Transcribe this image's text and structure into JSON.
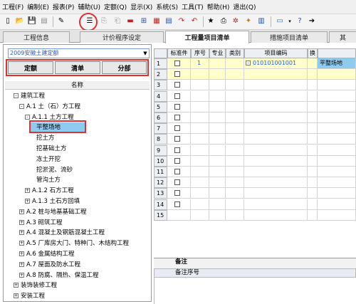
{
  "menu": [
    "工程(F)",
    "编制(E)",
    "报表(P)",
    "辅助(U)",
    "定额(Q)",
    "显示(X)",
    "系统(S)",
    "工具(T)",
    "帮助(H)",
    "退出(Q)"
  ],
  "tabs": [
    "工程信息",
    "计价程序设定",
    "工程量项目清单",
    "措施项目清单",
    "其"
  ],
  "active_tab": "工程量项目清单",
  "left_panel": {
    "quota_select": "2009安徽土建定额",
    "subtabs": [
      "定额",
      "清单",
      "分部"
    ],
    "tree_header": "名称",
    "tree": [
      {
        "label": "建筑工程",
        "level": 0,
        "toggle": "-"
      },
      {
        "label": "A.1 土（石）方工程",
        "level": 1,
        "toggle": "-"
      },
      {
        "label": "A.1.1 土方工程",
        "level": 2,
        "toggle": "-"
      },
      {
        "label": "平整场地",
        "level": 3,
        "toggle": "",
        "selected": true
      },
      {
        "label": "挖土方",
        "level": 3,
        "toggle": ""
      },
      {
        "label": "挖基础土方",
        "level": 3,
        "toggle": ""
      },
      {
        "label": "冻土开挖",
        "level": 3,
        "toggle": ""
      },
      {
        "label": "挖淤泥、流砂",
        "level": 3,
        "toggle": ""
      },
      {
        "label": "管沟土方",
        "level": 3,
        "toggle": ""
      },
      {
        "label": "A.1.2 石方工程",
        "level": 2,
        "toggle": "+"
      },
      {
        "label": "A.1.3 土石方回填",
        "level": 2,
        "toggle": "+"
      },
      {
        "label": "A.2 桩与地基基础工程",
        "level": 1,
        "toggle": "+"
      },
      {
        "label": "A.3 砌筑工程",
        "level": 1,
        "toggle": "+"
      },
      {
        "label": "A.4 混凝土及钢筋混凝土工程",
        "level": 1,
        "toggle": "+"
      },
      {
        "label": "A.5 厂库房大门、特种门、木结构工程",
        "level": 1,
        "toggle": "+"
      },
      {
        "label": "A.6 金属结构工程",
        "level": 1,
        "toggle": "+"
      },
      {
        "label": "A.7 屋面及防水工程",
        "level": 1,
        "toggle": "+"
      },
      {
        "label": "A.8 防腐、隔热、保温工程",
        "level": 1,
        "toggle": "+"
      },
      {
        "label": "装饰装修工程",
        "level": 0,
        "toggle": "+"
      },
      {
        "label": "安装工程",
        "level": 0,
        "toggle": "+"
      }
    ]
  },
  "grid": {
    "headers": [
      "标准件",
      "序号",
      "专业",
      "类别",
      "项目编码",
      "换",
      ""
    ],
    "rows": [
      {
        "num": "1",
        "seq": "1",
        "code": "010101001001",
        "name": "平整场地"
      },
      {
        "num": "2"
      },
      {
        "num": "3"
      },
      {
        "num": "4"
      },
      {
        "num": "5"
      },
      {
        "num": "6"
      },
      {
        "num": "7"
      },
      {
        "num": "8"
      },
      {
        "num": "9"
      },
      {
        "num": "10"
      },
      {
        "num": "11"
      },
      {
        "num": "12"
      },
      {
        "num": "13"
      },
      {
        "num": "14"
      },
      {
        "num": "15"
      }
    ]
  },
  "remarks": {
    "title": "备注",
    "col_header": "备注序号"
  },
  "colors": {
    "accent": "#e03030",
    "selection": "#8fcbee",
    "code_text": "#2060d0"
  }
}
